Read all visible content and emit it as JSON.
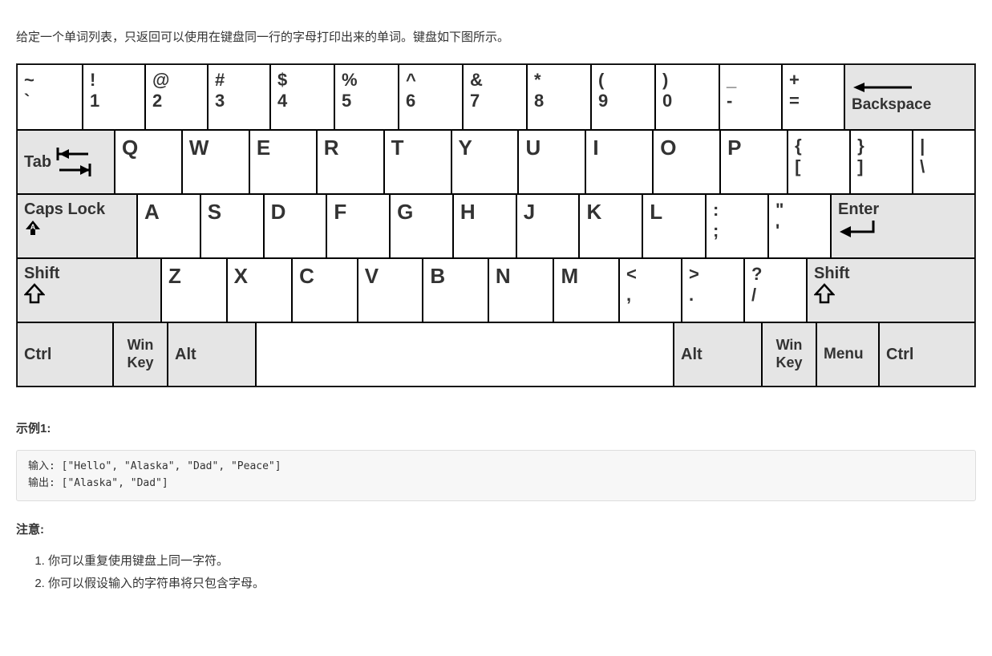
{
  "intro": "给定一个单词列表，只返回可以使用在键盘同一行的字母打印出来的单词。键盘如下图所示。",
  "keyboard": {
    "row1": [
      {
        "top": "~",
        "bot": "`"
      },
      {
        "top": "!",
        "bot": "1"
      },
      {
        "top": "@",
        "bot": "2"
      },
      {
        "top": "#",
        "bot": "3"
      },
      {
        "top": "$",
        "bot": "4"
      },
      {
        "top": "%",
        "bot": "5"
      },
      {
        "top": "^",
        "bot": "6"
      },
      {
        "top": "&",
        "bot": "7"
      },
      {
        "top": "*",
        "bot": "8"
      },
      {
        "top": "(",
        "bot": "9"
      },
      {
        "top": ")",
        "bot": "0"
      },
      {
        "top": "_",
        "bot": "-"
      },
      {
        "top": "+",
        "bot": "="
      }
    ],
    "backspace": "Backspace",
    "tab": "Tab",
    "row2": [
      "Q",
      "W",
      "E",
      "R",
      "T",
      "Y",
      "U",
      "I",
      "O",
      "P"
    ],
    "row2b": [
      {
        "top": "{",
        "bot": "["
      },
      {
        "top": "}",
        "bot": "]"
      },
      {
        "top": "|",
        "bot": "\\"
      }
    ],
    "caps": "Caps Lock",
    "row3": [
      "A",
      "S",
      "D",
      "F",
      "G",
      "H",
      "J",
      "K",
      "L"
    ],
    "row3b": [
      {
        "top": ":",
        "bot": ";"
      },
      {
        "top": "\"",
        "bot": "'"
      }
    ],
    "enter": "Enter",
    "shift": "Shift",
    "row4": [
      "Z",
      "X",
      "C",
      "V",
      "B",
      "N",
      "M"
    ],
    "row4b": [
      {
        "top": "<",
        "bot": ","
      },
      {
        "top": ">",
        "bot": "."
      },
      {
        "top": "?",
        "bot": "/"
      }
    ],
    "shift2": "Shift",
    "row5": {
      "ctrl": "Ctrl",
      "win": "Win Key",
      "alt": "Alt",
      "alt2": "Alt",
      "win2": "Win Key",
      "menu": "Menu",
      "ctrl2": "Ctrl"
    }
  },
  "example_heading": "示例1:",
  "example_input_label": "输入: ",
  "example_input_value": "[\"Hello\", \"Alaska\", \"Dad\", \"Peace\"]",
  "example_output_label": "输出: ",
  "example_output_value": "[\"Alaska\", \"Dad\"]",
  "notes_heading": "注意:",
  "notes": [
    "你可以重复使用键盘上同一字符。",
    "你可以假设输入的字符串将只包含字母。"
  ]
}
